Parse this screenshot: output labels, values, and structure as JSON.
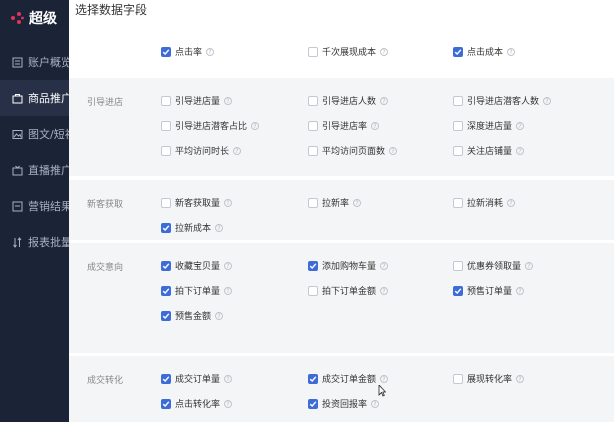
{
  "app": {
    "logo_text": "超级"
  },
  "sidebar": {
    "items": [
      {
        "label": "账户概览",
        "icon": "account-icon"
      },
      {
        "label": "商品推广",
        "icon": "bag-icon",
        "active": true
      },
      {
        "label": "图文/短视",
        "icon": "image-icon"
      },
      {
        "label": "直播推广",
        "icon": "tv-icon"
      },
      {
        "label": "营销结果",
        "icon": "report-icon"
      },
      {
        "label": "报表批量",
        "icon": "sort-icon"
      }
    ]
  },
  "panel": {
    "title": "选择数据字段",
    "help_glyph": "?",
    "top_row": [
      {
        "label": "点击率",
        "checked": true
      },
      {
        "label": "千次展现成本",
        "checked": false
      },
      {
        "label": "点击成本",
        "checked": true
      }
    ],
    "groups": [
      {
        "label": "引导进店",
        "items": [
          {
            "label": "引导进店量",
            "checked": false
          },
          {
            "label": "引导进店人数",
            "checked": false
          },
          {
            "label": "引导进店潜客人数",
            "checked": false
          },
          {
            "label": "引导进店潜客占比",
            "checked": false
          },
          {
            "label": "引导进店率",
            "checked": false
          },
          {
            "label": "深度进店量",
            "checked": false
          },
          {
            "label": "平均访问时长",
            "checked": false
          },
          {
            "label": "平均访问页面数",
            "checked": false
          },
          {
            "label": "关注店铺量",
            "checked": false
          }
        ]
      },
      {
        "label": "新客获取",
        "items": [
          {
            "label": "新客获取量",
            "checked": false
          },
          {
            "label": "拉新率",
            "checked": false
          },
          {
            "label": "拉新消耗",
            "checked": false
          },
          {
            "label": "拉新成本",
            "checked": true
          }
        ]
      },
      {
        "label": "成交意向",
        "items": [
          {
            "label": "收藏宝贝量",
            "checked": true
          },
          {
            "label": "添加购物车量",
            "checked": true
          },
          {
            "label": "优惠券领取量",
            "checked": false
          },
          {
            "label": "拍下订单量",
            "checked": true
          },
          {
            "label": "拍下订单金额",
            "checked": false
          },
          {
            "label": "预售订单量",
            "checked": true
          },
          {
            "label": "预售金额",
            "checked": true
          }
        ]
      },
      {
        "label": "成交转化",
        "items": [
          {
            "label": "成交订单量",
            "checked": true
          },
          {
            "label": "成交订单金额",
            "checked": true
          },
          {
            "label": "展现转化率",
            "checked": false
          },
          {
            "label": "点击转化率",
            "checked": true
          },
          {
            "label": "投资回报率",
            "checked": true
          }
        ]
      }
    ]
  },
  "colors": {
    "accent": "#3d6cd9",
    "sidebar_bg": "#1b2437",
    "group_bg": "#f4f5f7"
  }
}
